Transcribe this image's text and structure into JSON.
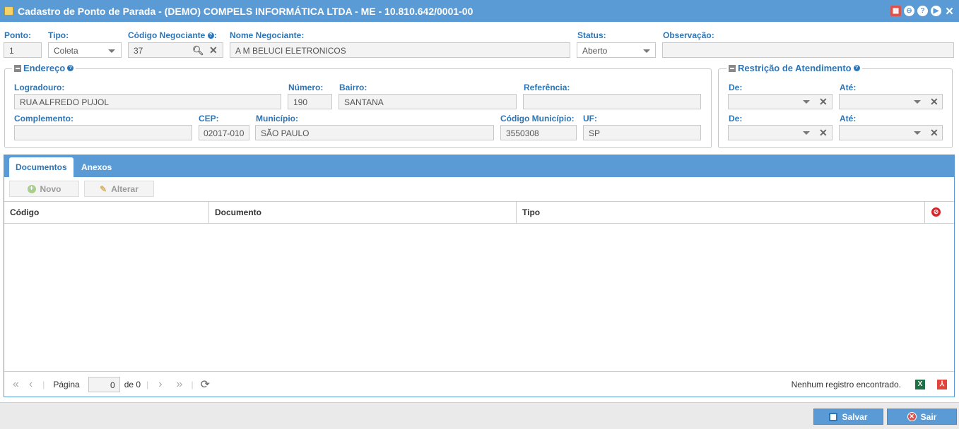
{
  "window": {
    "title": "Cadastro de Ponto de Parada - (DEMO) COMPELS INFORMÁTICA LTDA - ME - 10.810.642/0001-00"
  },
  "form": {
    "ponto": {
      "label": "Ponto:",
      "value": "1"
    },
    "tipo": {
      "label": "Tipo:",
      "value": "Coleta"
    },
    "codigo_negociante": {
      "label": "Código Negociante",
      "value": "37"
    },
    "nome_negociante": {
      "label": "Nome Negociante:",
      "value": "A M BELUCI ELETRONICOS"
    },
    "status": {
      "label": "Status:",
      "value": "Aberto"
    },
    "observacao": {
      "label": "Observação:",
      "value": ""
    }
  },
  "endereco": {
    "legend": "Endereço",
    "logradouro": {
      "label": "Logradouro:",
      "value": "RUA ALFREDO PUJOL"
    },
    "numero": {
      "label": "Número:",
      "value": "190"
    },
    "bairro": {
      "label": "Bairro:",
      "value": "SANTANA"
    },
    "referencia": {
      "label": "Referência:",
      "value": ""
    },
    "complemento": {
      "label": "Complemento:",
      "value": ""
    },
    "cep": {
      "label": "CEP:",
      "value": "02017-010"
    },
    "municipio": {
      "label": "Município:",
      "value": "SÃO PAULO"
    },
    "codigo_municipio": {
      "label": "Código Município:",
      "value": "3550308"
    },
    "uf": {
      "label": "UF:",
      "value": "SP"
    }
  },
  "restricao": {
    "legend": "Restrição de Atendimento",
    "de1": {
      "label": "De:",
      "value": ""
    },
    "ate1": {
      "label": "Até:",
      "value": ""
    },
    "de2": {
      "label": "De:",
      "value": ""
    },
    "ate2": {
      "label": "Até:",
      "value": ""
    }
  },
  "tabs": [
    {
      "label": "Documentos"
    },
    {
      "label": "Anexos"
    }
  ],
  "toolbar": {
    "novo": "Novo",
    "alterar": "Alterar"
  },
  "grid": {
    "columns": [
      "Código",
      "Documento",
      "Tipo"
    ],
    "rows": []
  },
  "pager": {
    "pagina_label": "Página",
    "page": "0",
    "of_text": "de 0",
    "status": "Nenhum registro encontrado."
  },
  "footer": {
    "salvar": "Salvar",
    "sair": "Sair"
  }
}
